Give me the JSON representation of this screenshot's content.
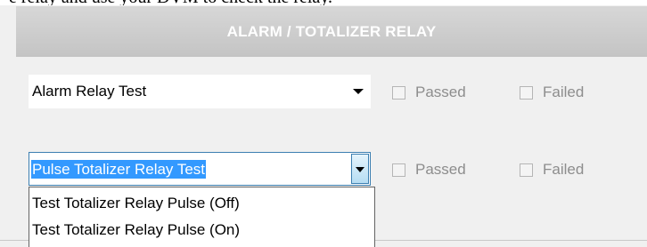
{
  "document": {
    "text": "e relay and use your DVM to check the relay."
  },
  "panel": {
    "title": "ALARM / TOTALIZER RELAY",
    "rows": [
      {
        "select_value": "Alarm Relay Test",
        "passed_label": "Passed",
        "failed_label": "Failed"
      },
      {
        "select_value": "Pulse Totalizer Relay Test",
        "passed_label": "Passed",
        "failed_label": "Failed"
      }
    ],
    "dropdown_options": [
      "Test Totalizer Relay Pulse (Off)",
      "Test Totalizer Relay Pulse (On)"
    ]
  },
  "colors": {
    "header_background": "#c8c8c8",
    "selection_highlight": "#3399ff",
    "focus_border": "#3c7fb1",
    "disabled_text": "#8d8d8d"
  },
  "icons": [
    "dropdown-arrow-icon",
    "checkbox-icon"
  ]
}
